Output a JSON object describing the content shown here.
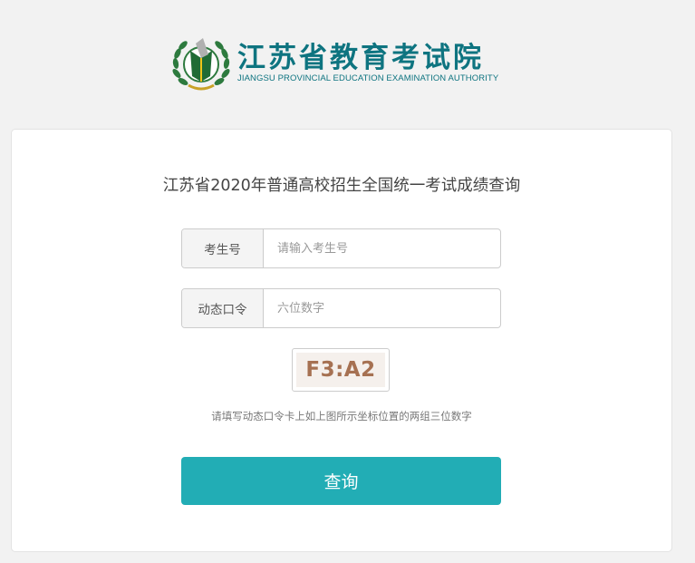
{
  "header": {
    "logo_icon": "jiangsu-education-exam-authority-emblem",
    "title": "江苏省教育考试院",
    "subtitle": "JIANGSU PROVINCIAL EDUCATION EXAMINATION AUTHORITY",
    "brand_color": "#0e7480"
  },
  "form": {
    "title": "江苏省2020年普通高校招生全国统一考试成绩查询",
    "candidate_label": "考生号",
    "candidate_placeholder": "请输入考生号",
    "candidate_value": "",
    "token_label": "动态口令",
    "token_placeholder": "六位数字",
    "token_value": "",
    "captcha_text": "F3:A2",
    "hint": "请填写动态口令卡上如上图所示坐标位置的两组三位数字",
    "submit_label": "查询",
    "accent_color": "#22adb5"
  }
}
